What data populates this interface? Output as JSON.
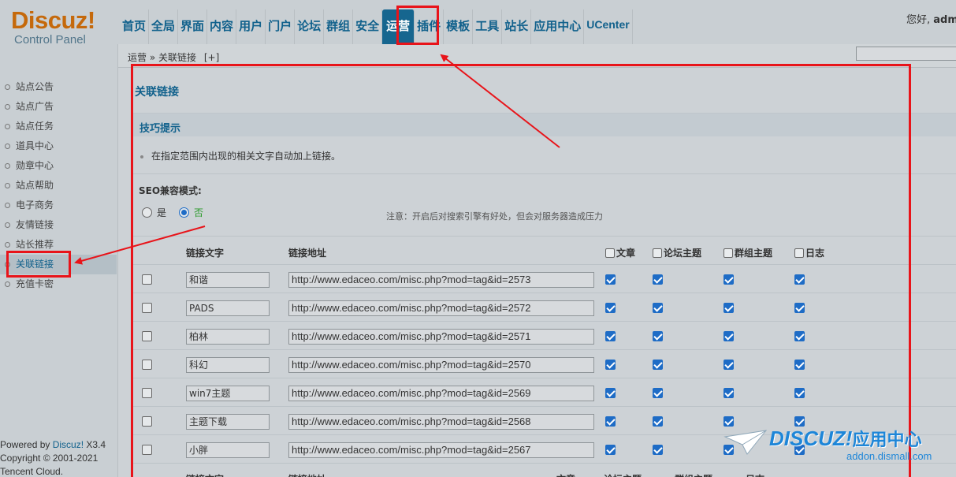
{
  "logo": {
    "brand": "Discuz!",
    "sub": "Control Panel"
  },
  "topnav": {
    "items": [
      {
        "label": "首页"
      },
      {
        "label": "全局"
      },
      {
        "label": "界面"
      },
      {
        "label": "内容"
      },
      {
        "label": "用户"
      },
      {
        "label": "门户"
      },
      {
        "label": "论坛"
      },
      {
        "label": "群组"
      },
      {
        "label": "安全"
      },
      {
        "label": "运营",
        "active": true
      },
      {
        "label": "插件"
      },
      {
        "label": "模板"
      },
      {
        "label": "工具"
      },
      {
        "label": "站长"
      },
      {
        "label": "应用中心"
      },
      {
        "label": "UCenter"
      }
    ],
    "greeting": "您好,",
    "username": "adm"
  },
  "breadcrumb": {
    "parent": "运营",
    "sep": "»",
    "current": "关联链接",
    "add": "[+]"
  },
  "sidebar": {
    "items": [
      {
        "label": "站点公告"
      },
      {
        "label": "站点广告"
      },
      {
        "label": "站点任务"
      },
      {
        "label": "道具中心"
      },
      {
        "label": "勋章中心"
      },
      {
        "label": "站点帮助"
      },
      {
        "label": "电子商务"
      },
      {
        "label": "友情链接"
      },
      {
        "label": "站长推荐"
      },
      {
        "label": "关联链接",
        "active": true
      },
      {
        "label": "充值卡密"
      }
    ],
    "footer": {
      "powered_prefix": "Powered by",
      "powered_link": "Discuz!",
      "version": "X3.4",
      "copyright": "Copyright © 2001-2021",
      "company": "Tencent Cloud."
    }
  },
  "main": {
    "title": "关联链接",
    "tips_title": "技巧提示",
    "tip": "在指定范围内出现的相关文字自动加上链接。",
    "seo_label": "SEO兼容模式:",
    "seo_yes": "是",
    "seo_no": "否",
    "seo_selected": "否",
    "seo_note": "注意：开启后对搜索引擎有好处，但会对服务器造成压力"
  },
  "table": {
    "headers": {
      "text": "链接文字",
      "url": "链接地址",
      "article": "文章",
      "forum": "论坛主题",
      "group": "群组主题",
      "blog": "日志"
    },
    "rows": [
      {
        "text": "和谐",
        "url": "http://www.edaceo.com/misc.php?mod=tag&id=2573",
        "article": true,
        "forum": true,
        "group": true,
        "blog": true
      },
      {
        "text": "PADS",
        "url": "http://www.edaceo.com/misc.php?mod=tag&id=2572",
        "article": true,
        "forum": true,
        "group": true,
        "blog": true
      },
      {
        "text": "柏林",
        "url": "http://www.edaceo.com/misc.php?mod=tag&id=2571",
        "article": true,
        "forum": true,
        "group": true,
        "blog": true
      },
      {
        "text": "科幻",
        "url": "http://www.edaceo.com/misc.php?mod=tag&id=2570",
        "article": true,
        "forum": true,
        "group": true,
        "blog": true
      },
      {
        "text": "win7主题",
        "url": "http://www.edaceo.com/misc.php?mod=tag&id=2569",
        "article": true,
        "forum": true,
        "group": true,
        "blog": true
      },
      {
        "text": "主题下载",
        "url": "http://www.edaceo.com/misc.php?mod=tag&id=2568",
        "article": true,
        "forum": true,
        "group": true,
        "blog": true
      },
      {
        "text": "小胖",
        "url": "http://www.edaceo.com/misc.php?mod=tag&id=2567",
        "article": true,
        "forum": true,
        "group": true,
        "blog": true
      }
    ]
  },
  "watermark": {
    "brand": "DISCUZ!",
    "brand_cn": "应用中心",
    "domain": "addon.dismall.com"
  },
  "colors": {
    "accent": "#11618c",
    "logo": "#c5690b",
    "annotation": "#e8141a",
    "checkbox": "#1e6cc6"
  }
}
